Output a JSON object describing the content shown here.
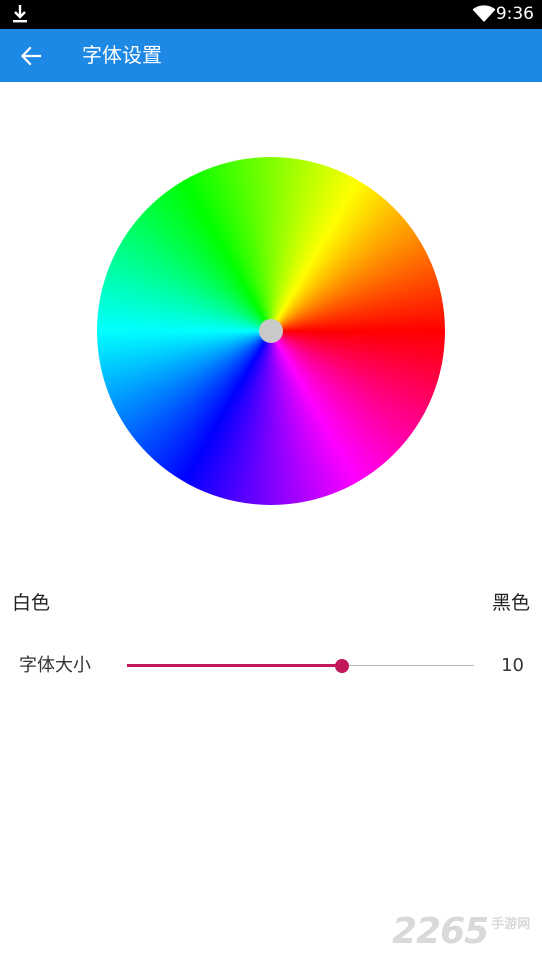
{
  "status_bar": {
    "time": "9:36",
    "icons": [
      "download-icon",
      "wifi-icon"
    ]
  },
  "app_bar": {
    "title": "字体设置",
    "back_icon": "arrow-back-icon",
    "color": "#1e88e5"
  },
  "color_picker": {
    "selector_color": "#c9c9c9",
    "label_left": "白色",
    "label_right": "黑色"
  },
  "font_size": {
    "label": "字体大小",
    "value": "10",
    "slider_fraction": 0.62,
    "accent_color": "#c2185b"
  },
  "watermark": {
    "digits": "2265",
    "site": "手游网"
  }
}
